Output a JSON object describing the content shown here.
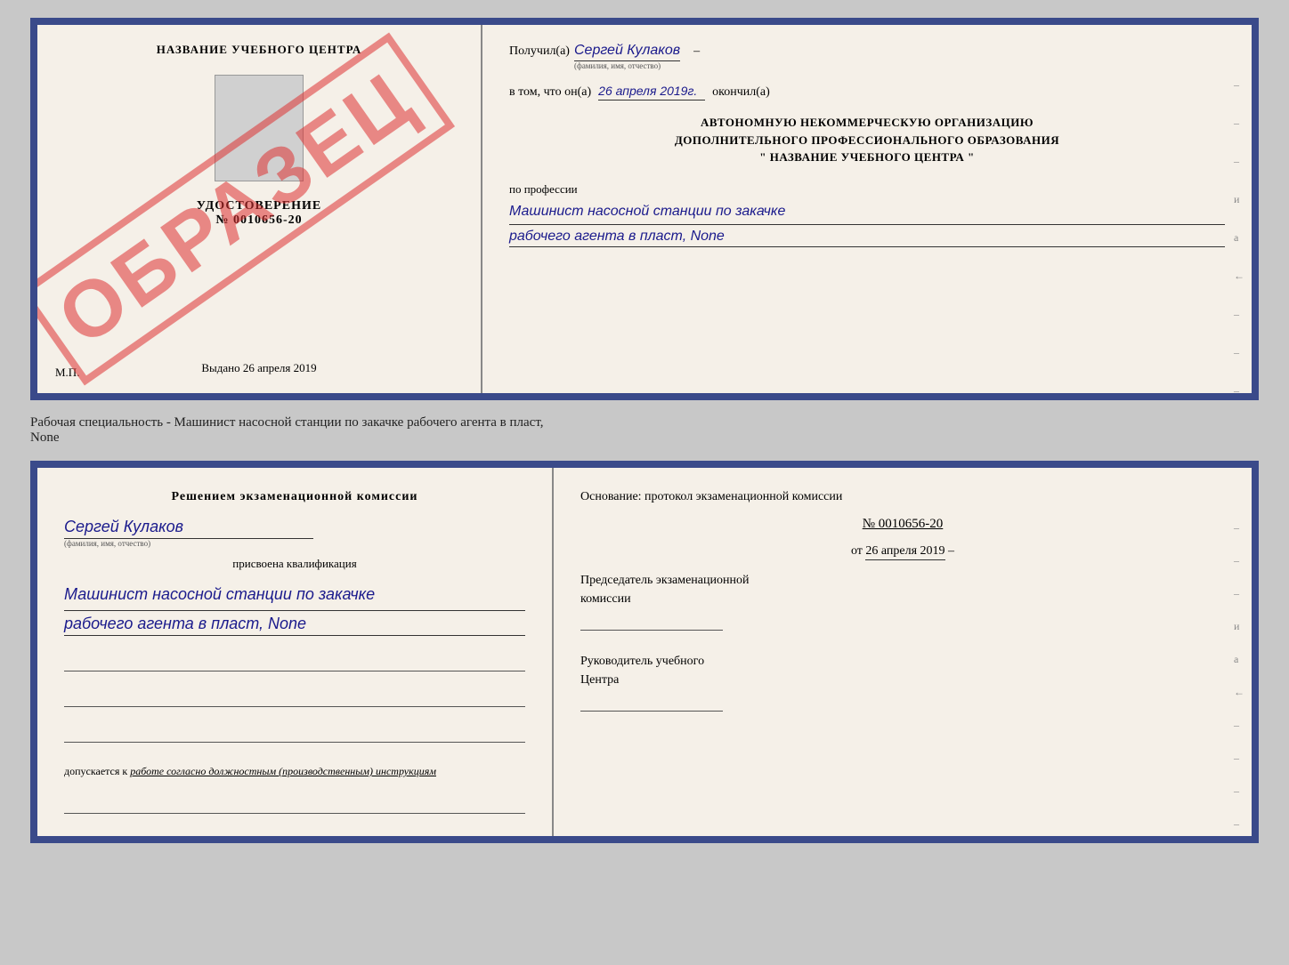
{
  "top_cert": {
    "left": {
      "center_name": "НАЗВАНИЕ УЧЕБНОГО ЦЕНТРА",
      "udostoverenie_title": "УДОСТОВЕРЕНИЕ",
      "udostoverenie_number": "№ 0010656-20",
      "vydano_label": "Выдано",
      "vydano_date": "26 апреля 2019",
      "mp_label": "М.П.",
      "obrazets": "ОБРАЗЕЦ"
    },
    "right": {
      "poluchil_label": "Получил(а)",
      "poluchil_name": "Сергей Кулаков",
      "fio_hint": "(фамилия, имя, отчество)",
      "v_tom_label": "в том, что он(а)",
      "date_value": "26 апреля 2019г.",
      "okonchil_label": "окончил(а)",
      "org_line1": "АВТОНОМНУЮ НЕКОММЕРЧЕСКУЮ ОРГАНИЗАЦИЮ",
      "org_line2": "ДОПОЛНИТЕЛЬНОГО ПРОФЕССИОНАЛЬНОГО ОБРАЗОВАНИЯ",
      "org_quote": "\"  НАЗВАНИЕ УЧЕБНОГО ЦЕНТРА  \"",
      "po_professii_label": "по профессии",
      "profession_line1": "Машинист насосной станции по закачке",
      "profession_line2": "рабочего агента в пласт, None"
    }
  },
  "subtitle": "Рабочая специальность - Машинист насосной станции по закачке рабочего агента в пласт,",
  "subtitle2": "None",
  "bottom_cert": {
    "left": {
      "resheniem_text": "Решением экзаменационной комиссии",
      "name_value": "Сергей Кулаков",
      "fio_hint": "(фамилия, имя, отчество)",
      "prisvoena_label": "присвоена квалификация",
      "kvali_line1": "Машинист насосной станции по закачке",
      "kvali_line2": "рабочего агента в пласт, None",
      "dopusk_prefix": "допускается к",
      "dopusk_text": "работе согласно должностным (производственным) инструкциям"
    },
    "right": {
      "osnovanie_label": "Основание: протокол экзаменационной комиссии",
      "protocol_number": "№ 0010656-20",
      "protocol_date_prefix": "от",
      "protocol_date": "26 апреля 2019",
      "predsedatel_label": "Председатель экзаменационной",
      "predsedatel_label2": "комиссии",
      "rukovoditel_label": "Руководитель учебного",
      "rukovoditel_label2": "Центра"
    }
  },
  "dashes": [
    "-",
    "-",
    "-",
    "и",
    "а",
    "←",
    "-",
    "-",
    "-"
  ],
  "dashes_bottom": [
    "-",
    "-",
    "-",
    "и",
    "а",
    "←",
    "-",
    "-",
    "-",
    "-"
  ]
}
